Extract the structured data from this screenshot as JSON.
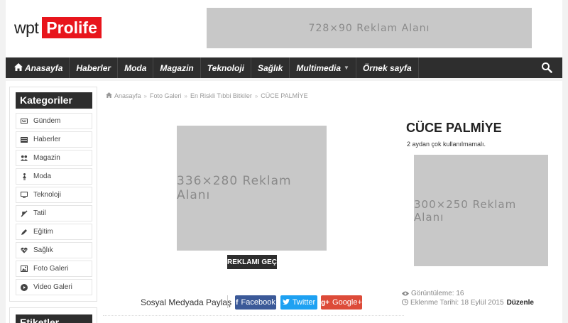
{
  "header": {
    "logo_left": "wpt",
    "logo_right": "Prolife",
    "top_ad": "728×90 Reklam Alanı"
  },
  "nav": {
    "items": [
      "Anasayfa",
      "Haberler",
      "Moda",
      "Magazin",
      "Teknoloji",
      "Sağlık",
      "Multimedia",
      "Örnek sayfa"
    ]
  },
  "sidebar": {
    "title": "Kategoriler",
    "items": [
      "Gündem",
      "Haberler",
      "Magazin",
      "Moda",
      "Teknoloji",
      "Tatil",
      "Eğitim",
      "Sağlık",
      "Foto Galeri",
      "Video Galeri"
    ],
    "title2": "Etiketler"
  },
  "breadcrumb": [
    "Anasayfa",
    "Foto Galeri",
    "En Riskli Tıbbi Bitkiler",
    "CÜCE PALMİYE"
  ],
  "main": {
    "ad": "336×280 Reklam Alanı",
    "skip": "REKLAMI GEÇ"
  },
  "article": {
    "title": "CÜCE PALMİYE",
    "subtitle": "2 aydan çok kullanılmamalı.",
    "side_ad": "300×250 Reklam Alanı"
  },
  "share": {
    "label": "Sosyal Medyada Paylaş",
    "facebook": "Facebook",
    "twitter": "Twitter",
    "google": "Google+"
  },
  "meta": {
    "views": "Görüntüleme: 16",
    "date": "Eklenme Tarihi: 18 Eylül 2015",
    "edit": "Düzenle"
  }
}
